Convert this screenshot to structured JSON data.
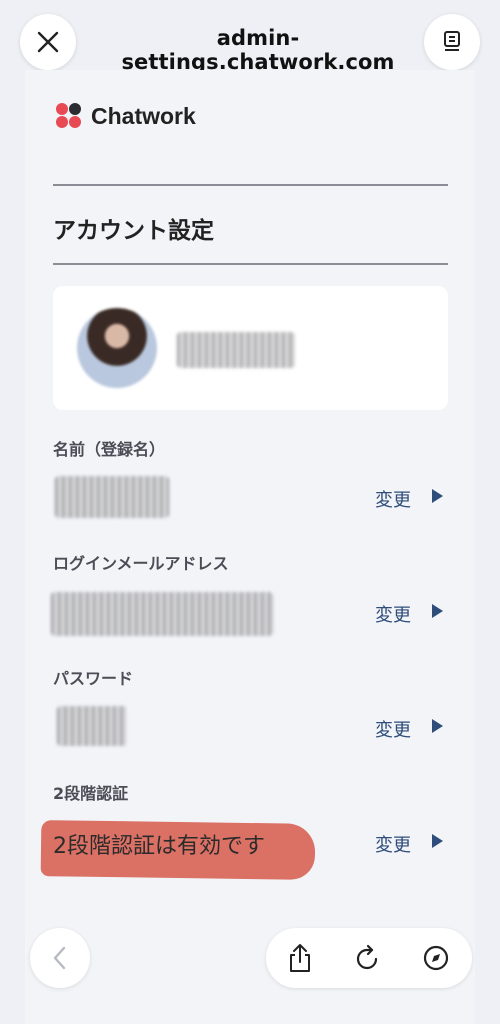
{
  "browser": {
    "url": "admin-settings.chatwork.com",
    "close_icon": "close-icon",
    "tabs_icon": "tabs-icon"
  },
  "page": {
    "logo_text": "Chatwork",
    "section_title": "アカウント設定",
    "fields": [
      {
        "label": "名前（登録名）",
        "action": "変更"
      },
      {
        "label": "ログインメールアドレス",
        "action": "変更"
      },
      {
        "label": "パスワード",
        "action": "変更"
      },
      {
        "label": "2段階認証",
        "action": "変更",
        "value": "2段階認証は有効です"
      }
    ]
  },
  "toolbar": {
    "back_icon": "chevron-left-icon",
    "share_icon": "share-icon",
    "reload_icon": "reload-icon",
    "compass_icon": "compass-icon"
  },
  "colors": {
    "accent": "#2e4d7a",
    "highlight": "#d9685c",
    "logo_red": "#e84a54"
  }
}
